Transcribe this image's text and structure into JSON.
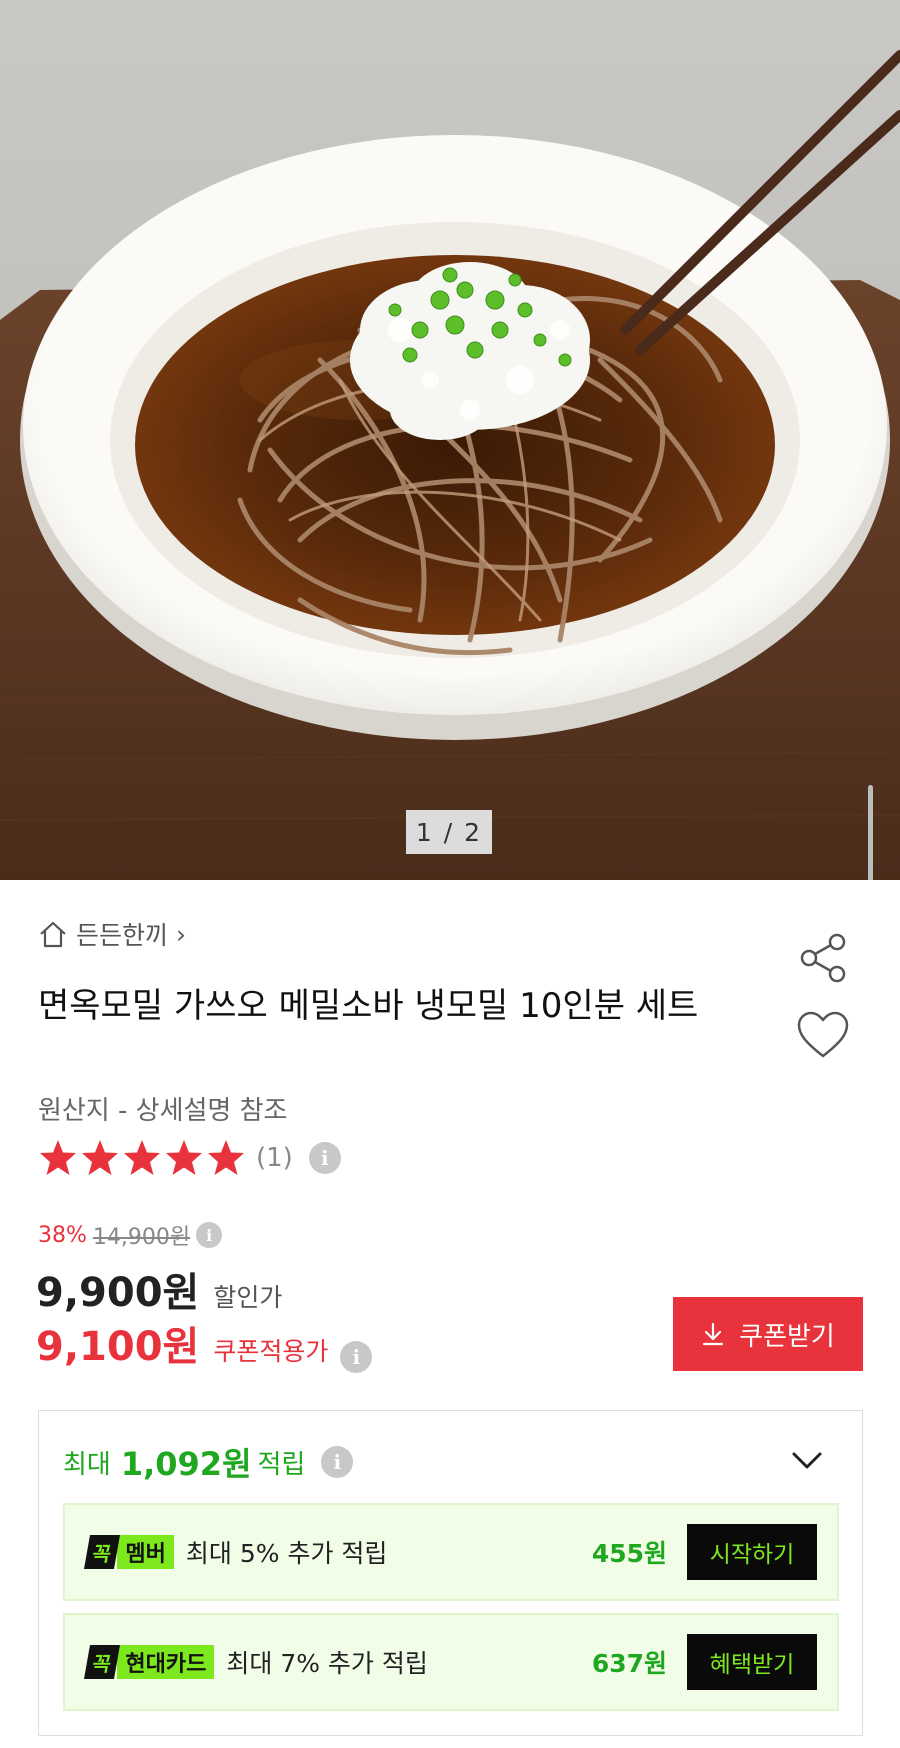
{
  "gallery": {
    "pager": "1 / 2",
    "image_alt": "buckwheat soba noodles in cold broth with grated radish and scallions"
  },
  "breadcrumb": {
    "brand": "든든한끼",
    "chevron": "›"
  },
  "product": {
    "title": "면옥모밀 가쓰오 메밀소바 냉모밀 10인분 세트",
    "origin": "원산지 - 상세설명 참조",
    "rating": {
      "stars": 5,
      "max": 5,
      "count": "(1)"
    },
    "star_color": "#e8323c"
  },
  "price": {
    "discount_rate": "38%",
    "original": "14,900원",
    "sale_price": "9,900원",
    "sale_label": "할인가",
    "coupon_price": "9,100원",
    "coupon_label": "쿠폰적용가",
    "coupon_button": "쿠폰받기",
    "accent_color": "#e8323c"
  },
  "points": {
    "prefix": "최대",
    "amount": "1,092원",
    "suffix": "적립",
    "accent_color": "#1fa81f",
    "benefits": [
      {
        "mark": "꼭",
        "name": "멤버",
        "text": "최대 5% 추가 적립",
        "amount": "455원",
        "button": "시작하기"
      },
      {
        "mark": "꼭",
        "name": "현대카드",
        "text": "최대 7% 추가 적립",
        "amount": "637원",
        "button": "혜택받기"
      }
    ]
  },
  "icons": {
    "home": "home-icon",
    "share": "share-icon",
    "like": "heart-icon",
    "info": "info-icon",
    "download": "download-icon",
    "expand": "chevron-down-icon"
  }
}
